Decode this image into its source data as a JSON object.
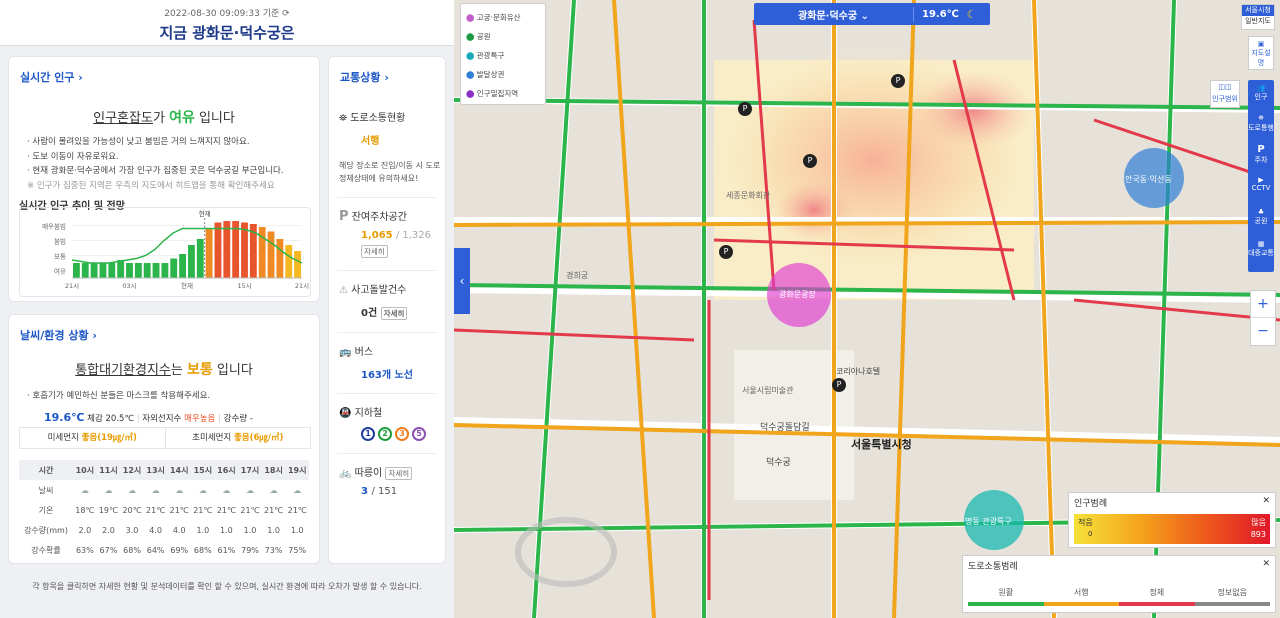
{
  "header": {
    "timestamp": "2022-08-30 09:09:33 기준",
    "refresh_icon": "refresh-icon",
    "title": "지금 광화문·덕수궁은"
  },
  "population": {
    "title": "실시간 인구",
    "headline_a": "인구혼잡도",
    "headline_b": "가",
    "level": "여유",
    "headline_c": "입니다",
    "bullets": [
      "사람이 몰려있을 가능성이 낮고 붐빔은 거의 느껴지지 않아요.",
      "도보 이동이 자유로워요.",
      "현재 광화문·덕수궁에서 가장 인구가 집중된 곳은 덕수궁길 부근입니다."
    ],
    "note": "※ 인구가 집중된 지역은 우측의 지도에서 히트맵을 통해 확인해주세요",
    "trend_title": "실시간 인구 추이 및 전망"
  },
  "chart_data": {
    "type": "bar",
    "title": "",
    "y_levels": [
      "매우붐빔",
      "붐빔",
      "보통",
      "여유"
    ],
    "x_ticks": [
      "21시",
      "03시",
      "현재",
      "15시",
      "21시"
    ],
    "now_label": "현재",
    "series": [
      {
        "name": "past",
        "color": "#2bb54a",
        "values": [
          1,
          1,
          1,
          1,
          1,
          1.2,
          1,
          1,
          1,
          1,
          1,
          1.3,
          1.6,
          2.2,
          2.6
        ]
      },
      {
        "name": "forecast",
        "color": "#e8542c",
        "values": [
          3.3,
          3.7,
          3.8,
          3.8,
          3.7,
          3.6,
          3.4,
          3.1,
          2.6,
          2.2,
          1.8
        ]
      }
    ],
    "line_values": [
      1.2,
      1.1,
      1,
      1,
      1,
      1.1,
      1.2,
      1.3,
      1.5,
      1.9,
      2.5,
      3.0,
      3.3,
      3.3,
      3.3,
      3.3,
      3.3,
      3.3,
      3.3,
      3.2,
      3.0,
      2.6,
      2.2,
      1.7,
      1.3,
      1.0
    ]
  },
  "weather": {
    "title": "날씨/환경 상황",
    "headline_a": "통합대기환경지수",
    "headline_b": "는",
    "level": "보통",
    "headline_c": "입니다",
    "bullet": "호흡기가 예민하신 분들은 마스크를 착용해주세요.",
    "temp": "19.6℃",
    "feel": "체감 20.5℃",
    "uv_label": "자외선지수",
    "uv": "매우높음",
    "rain": "강수량 -",
    "pm10_label": "미세먼지",
    "pm10": "좋음(19㎍/㎥)",
    "pm25_label": "초미세먼지",
    "pm25": "좋음(6㎍/㎥)",
    "table": {
      "times": [
        "시간",
        "10시",
        "11시",
        "12시",
        "13시",
        "14시",
        "15시",
        "16시",
        "17시",
        "18시",
        "19시"
      ],
      "sky_label": "날씨",
      "temps": [
        "기온",
        "18℃",
        "19℃",
        "20℃",
        "21℃",
        "21℃",
        "21℃",
        "21℃",
        "21℃",
        "21℃",
        "21℃"
      ],
      "rains": [
        "강수량(mm)",
        "2.0",
        "2.0",
        "3.0",
        "4.0",
        "4.0",
        "1.0",
        "1.0",
        "1.0",
        "1.0",
        "1.0"
      ],
      "probs": [
        "강수확률",
        "63%",
        "67%",
        "68%",
        "64%",
        "69%",
        "68%",
        "61%",
        "79%",
        "73%",
        "75%"
      ]
    }
  },
  "traffic": {
    "title": "교통상황",
    "road_title": "도로소통현황",
    "road_status": "서행",
    "road_desc": "해당 장소로 진입/이동 시 도로정체상태에 유의하세요!",
    "parking_title": "잔여주차공간",
    "parking_now": "1,065",
    "parking_total": "1,326",
    "detail": "자세히",
    "accident_title": "사고돌발건수",
    "accident": "0건",
    "bus_title": "버스",
    "bus": "163개 노선",
    "subway_title": "지하철",
    "subway_lines": [
      {
        "n": "1",
        "c": "#1f3f9e"
      },
      {
        "n": "2",
        "c": "#1f9d3c"
      },
      {
        "n": "3",
        "c": "#ef7c1c"
      },
      {
        "n": "5",
        "c": "#8b4fb3"
      }
    ],
    "bike_title": "따릉이",
    "bike_now": "3",
    "bike_total": "151"
  },
  "footer": "각 항목을 클릭하면 자세한 현황 및 분석데이터를 확인 할 수 있으며, 실시간 환경에 따라 오차가 발생 할 수 있습니다.",
  "map": {
    "legend": [
      {
        "label": "고궁·문화유산",
        "color": "#c05fc9"
      },
      {
        "label": "공원",
        "color": "#1a9b43"
      },
      {
        "label": "관광특구",
        "color": "#18a9b8"
      },
      {
        "label": "발달상권",
        "color": "#2e7fd5"
      },
      {
        "label": "인구밀집지역",
        "color": "#8a2fc4"
      }
    ],
    "place_select": "광화문·덕수궁",
    "temp": "19.6℃",
    "seoul_btn": "서울시청",
    "mode_btn": "일반지도",
    "side": [
      {
        "label": "지도설명"
      },
      {
        "label": "인구"
      },
      {
        "label": "도로통행"
      },
      {
        "label": "주차"
      },
      {
        "label": "CCTV"
      },
      {
        "label": "공원"
      },
      {
        "label": "대중교통"
      }
    ],
    "pop_range_btn": "인구범위",
    "zoom_in": "+",
    "zoom_out": "−",
    "pop_legend": {
      "title": "인구범례",
      "low": "적음",
      "high": "많음",
      "low_val": "0",
      "high_val": "893"
    },
    "road_legend": {
      "title": "도로소통범례",
      "items": [
        "원활",
        "서행",
        "정체",
        "정보없음"
      ],
      "colors": [
        "#2bb54a",
        "#f0a51c",
        "#e23a4a",
        "#888888"
      ]
    },
    "bubbles": [
      {
        "label": "안국동·익선동"
      },
      {
        "label": "명동 관광특구"
      },
      {
        "label": "광화문광장"
      }
    ],
    "labels": [
      "서울특별시청",
      "덕수궁",
      "덕수궁돌담길",
      "서울시립미술관",
      "세종문화회관",
      "경희궁",
      "코리아나호텔"
    ]
  }
}
